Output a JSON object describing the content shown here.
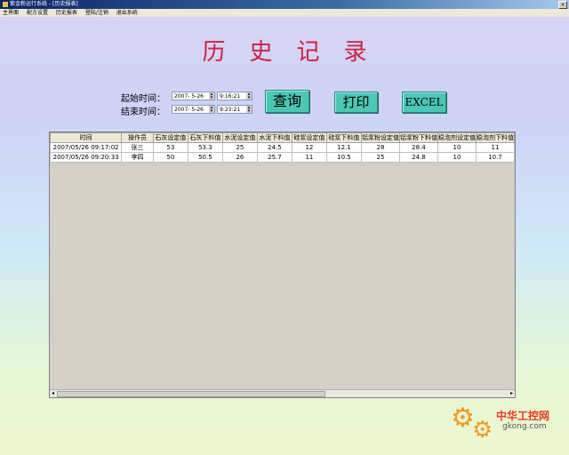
{
  "window": {
    "title": "紫金粉运行系统 - [历史报表]",
    "close_glyph": "×"
  },
  "menu": [
    "主界面",
    "配方设置",
    "历史报表",
    "登陆/注销",
    "退出系统"
  ],
  "page_title": "历史记录",
  "filter": {
    "start_label": "起始时间：",
    "end_label": "结束时间：",
    "start_date": "2007- 5-26",
    "start_time": "9:16:21",
    "end_date": "2007- 5-26",
    "end_time": "9:23:21"
  },
  "buttons": {
    "query": "查询",
    "print": "打印",
    "excel": "EXCEL"
  },
  "table": {
    "columns": [
      "时间",
      "操作员",
      "石灰设定值",
      "石灰下料值",
      "水泥设定值",
      "水泥下料值",
      "硅浆设定值",
      "硅浆下料值",
      "铝浆粉设定值",
      "铝浆粉下料值",
      "稳泡剂设定值",
      "稳泡剂下料值"
    ],
    "rows": [
      [
        "2007/05/26 09:17:02",
        "张三",
        "53",
        "53.3",
        "25",
        "24.5",
        "12",
        "12.1",
        "28",
        "28.4",
        "10",
        "11"
      ],
      [
        "2007/05/26 09:20:33",
        "李四",
        "50",
        "50.5",
        "26",
        "25.7",
        "11",
        "10.5",
        "25",
        "24.8",
        "10",
        "10.7"
      ]
    ]
  },
  "watermark": {
    "cn": "中华工控网",
    "en": "gkong.com"
  },
  "colors": {
    "title": "#cc2244",
    "button": "#4cc7b6",
    "grid_bg": "#d4d0c8"
  }
}
